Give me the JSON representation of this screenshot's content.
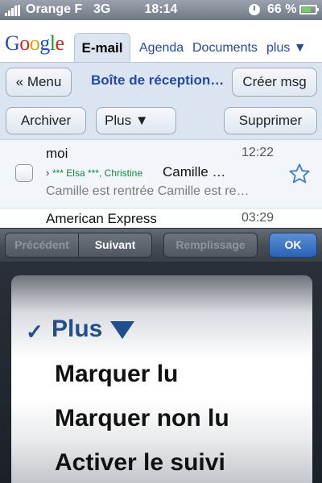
{
  "status_bar": {
    "carrier": "Orange F",
    "network": "3G",
    "time": "18:14",
    "battery": "66 %",
    "battery_level": 0.66
  },
  "tabs": {
    "logo": "Google",
    "active": "E-mail",
    "links": [
      "Agenda",
      "Documents",
      "plus ▼"
    ]
  },
  "toolbar": {
    "menu_label": "« Menu",
    "inbox_title": "Boîte de réception…",
    "compose_label": "Créer msg",
    "archive_label": "Archiver",
    "more_label": "Plus ▼",
    "delete_label": "Supprimer"
  },
  "emails": [
    {
      "sender": "moi",
      "time": "12:22",
      "recipients": "*** Elsa ***, Christine",
      "subject": "Camille …",
      "snippet": "Camille est rentrée Camille est re…"
    },
    {
      "sender": "American Express",
      "time": "03:29"
    }
  ],
  "assistant": {
    "prev": "Précédent",
    "next": "Suivant",
    "autofill": "Remplissage",
    "ok": "OK"
  },
  "picker": {
    "check": "✓",
    "selected": "Plus",
    "options": [
      "Marquer lu",
      "Marquer non lu",
      "Activer le suivi"
    ]
  },
  "colors": {
    "accent": "#2449a6",
    "recipients": "#128a38",
    "ok_button": "#2a62b8"
  }
}
